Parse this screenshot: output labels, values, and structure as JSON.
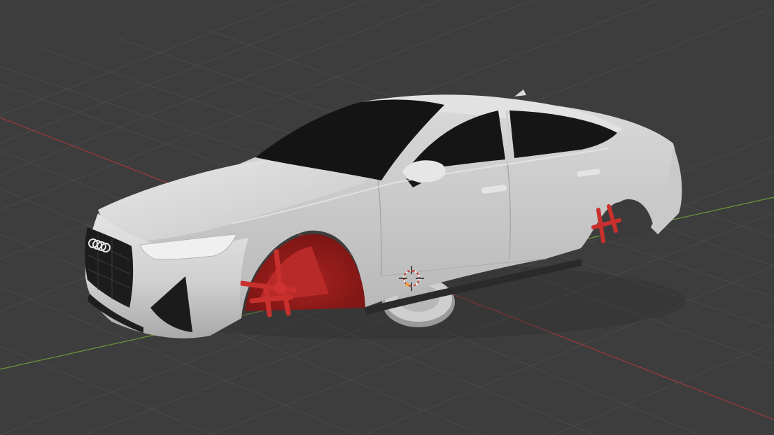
{
  "viewport": {
    "background_color": "#3d3d3d",
    "grid_color": "#4a4a4a",
    "grid_minor_color": "#444444",
    "x_axis_color": "#b03a3a",
    "y_axis_color": "#6a9a3a"
  },
  "scene": {
    "object": "car-body",
    "body_color": "#d2d2d2",
    "window_color": "#141414",
    "suspension_color": "#c8302e",
    "wheel_color": "#cfcfcf"
  },
  "gizmos": [
    "3d-cursor",
    "origin-point"
  ]
}
